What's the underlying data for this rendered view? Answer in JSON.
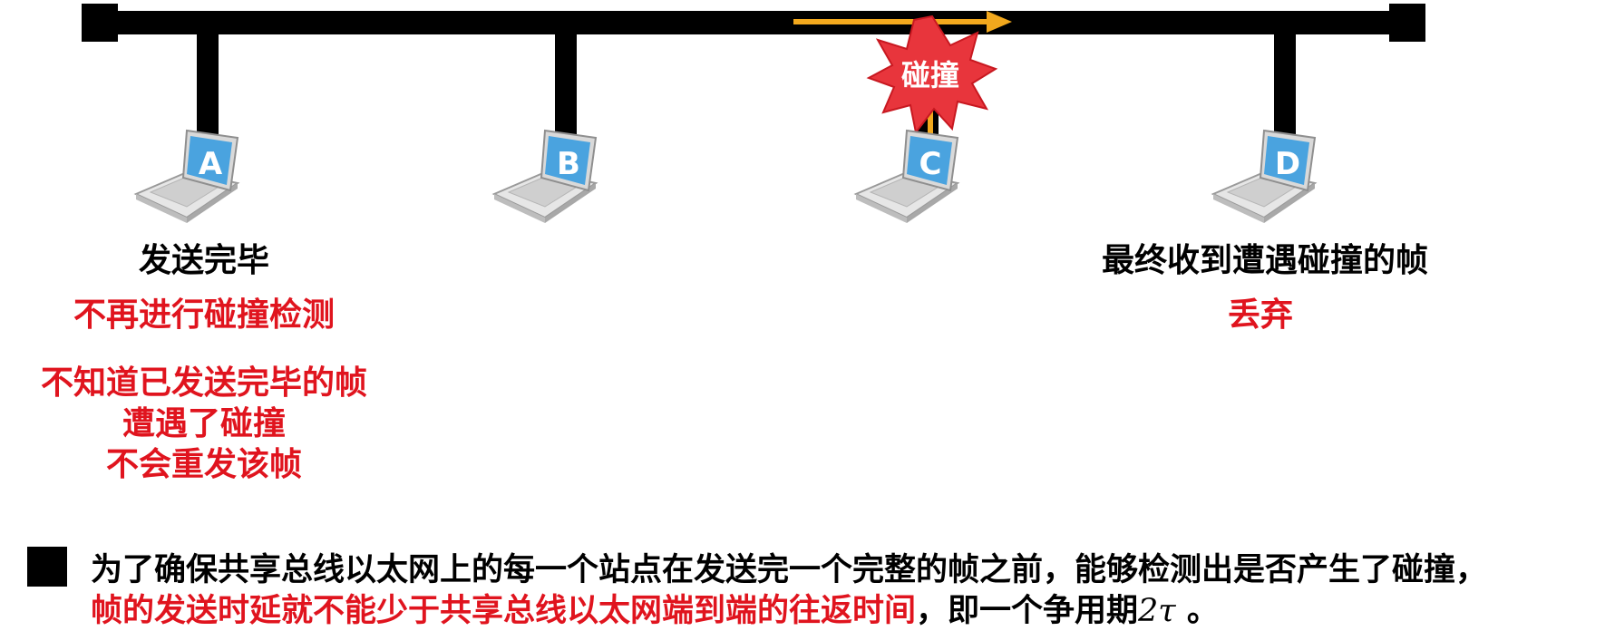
{
  "stations": [
    {
      "label": "A"
    },
    {
      "label": "B"
    },
    {
      "label": "C"
    },
    {
      "label": "D"
    }
  ],
  "collision_label": "碰撞",
  "left_notes": {
    "title": "发送完毕",
    "line1": "不再进行碰撞检测",
    "line2": "不知道已发送完毕的帧",
    "line3": "遭遇了碰撞",
    "line4": "不会重发该帧"
  },
  "right_notes": {
    "title": "最终收到遭遇碰撞的帧",
    "line1": "丢弃"
  },
  "bottom": {
    "line1": "为了确保共享总线以太网上的每一个站点在发送完一个完整的帧之前，能够检测出是否产生了碰撞，",
    "line2_red": "帧的发送时延就不能少于共享总线以太网端到端的往返时间",
    "line2_black": "，即一个争用期",
    "line2_math": "2τ",
    "line2_end": " 。"
  },
  "colors": {
    "red": "#e0141e",
    "arrow": "#f2a81d",
    "bus": "#000000",
    "laptop_screen": "#4aa3df"
  }
}
